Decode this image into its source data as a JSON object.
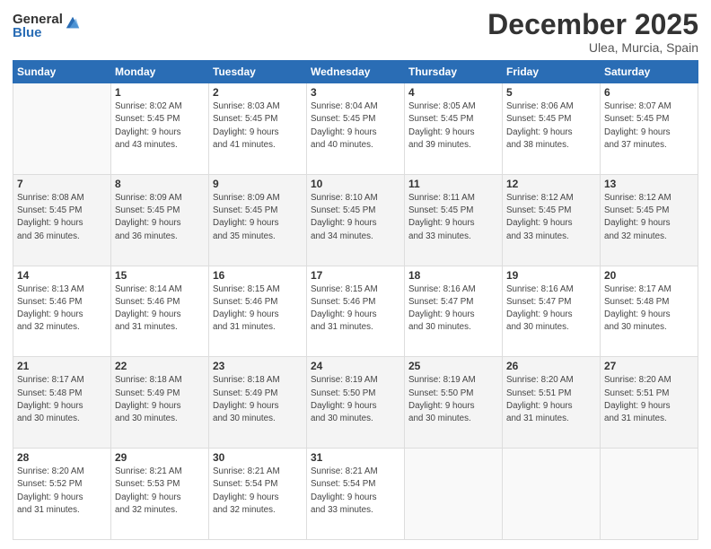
{
  "logo": {
    "general": "General",
    "blue": "Blue"
  },
  "header": {
    "month": "December 2025",
    "location": "Ulea, Murcia, Spain"
  },
  "days_of_week": [
    "Sunday",
    "Monday",
    "Tuesday",
    "Wednesday",
    "Thursday",
    "Friday",
    "Saturday"
  ],
  "weeks": [
    [
      {
        "day": "",
        "info": ""
      },
      {
        "day": "1",
        "info": "Sunrise: 8:02 AM\nSunset: 5:45 PM\nDaylight: 9 hours\nand 43 minutes."
      },
      {
        "day": "2",
        "info": "Sunrise: 8:03 AM\nSunset: 5:45 PM\nDaylight: 9 hours\nand 41 minutes."
      },
      {
        "day": "3",
        "info": "Sunrise: 8:04 AM\nSunset: 5:45 PM\nDaylight: 9 hours\nand 40 minutes."
      },
      {
        "day": "4",
        "info": "Sunrise: 8:05 AM\nSunset: 5:45 PM\nDaylight: 9 hours\nand 39 minutes."
      },
      {
        "day": "5",
        "info": "Sunrise: 8:06 AM\nSunset: 5:45 PM\nDaylight: 9 hours\nand 38 minutes."
      },
      {
        "day": "6",
        "info": "Sunrise: 8:07 AM\nSunset: 5:45 PM\nDaylight: 9 hours\nand 37 minutes."
      }
    ],
    [
      {
        "day": "7",
        "info": "Sunrise: 8:08 AM\nSunset: 5:45 PM\nDaylight: 9 hours\nand 36 minutes."
      },
      {
        "day": "8",
        "info": "Sunrise: 8:09 AM\nSunset: 5:45 PM\nDaylight: 9 hours\nand 36 minutes."
      },
      {
        "day": "9",
        "info": "Sunrise: 8:09 AM\nSunset: 5:45 PM\nDaylight: 9 hours\nand 35 minutes."
      },
      {
        "day": "10",
        "info": "Sunrise: 8:10 AM\nSunset: 5:45 PM\nDaylight: 9 hours\nand 34 minutes."
      },
      {
        "day": "11",
        "info": "Sunrise: 8:11 AM\nSunset: 5:45 PM\nDaylight: 9 hours\nand 33 minutes."
      },
      {
        "day": "12",
        "info": "Sunrise: 8:12 AM\nSunset: 5:45 PM\nDaylight: 9 hours\nand 33 minutes."
      },
      {
        "day": "13",
        "info": "Sunrise: 8:12 AM\nSunset: 5:45 PM\nDaylight: 9 hours\nand 32 minutes."
      }
    ],
    [
      {
        "day": "14",
        "info": "Sunrise: 8:13 AM\nSunset: 5:46 PM\nDaylight: 9 hours\nand 32 minutes."
      },
      {
        "day": "15",
        "info": "Sunrise: 8:14 AM\nSunset: 5:46 PM\nDaylight: 9 hours\nand 31 minutes."
      },
      {
        "day": "16",
        "info": "Sunrise: 8:15 AM\nSunset: 5:46 PM\nDaylight: 9 hours\nand 31 minutes."
      },
      {
        "day": "17",
        "info": "Sunrise: 8:15 AM\nSunset: 5:46 PM\nDaylight: 9 hours\nand 31 minutes."
      },
      {
        "day": "18",
        "info": "Sunrise: 8:16 AM\nSunset: 5:47 PM\nDaylight: 9 hours\nand 30 minutes."
      },
      {
        "day": "19",
        "info": "Sunrise: 8:16 AM\nSunset: 5:47 PM\nDaylight: 9 hours\nand 30 minutes."
      },
      {
        "day": "20",
        "info": "Sunrise: 8:17 AM\nSunset: 5:48 PM\nDaylight: 9 hours\nand 30 minutes."
      }
    ],
    [
      {
        "day": "21",
        "info": "Sunrise: 8:17 AM\nSunset: 5:48 PM\nDaylight: 9 hours\nand 30 minutes."
      },
      {
        "day": "22",
        "info": "Sunrise: 8:18 AM\nSunset: 5:49 PM\nDaylight: 9 hours\nand 30 minutes."
      },
      {
        "day": "23",
        "info": "Sunrise: 8:18 AM\nSunset: 5:49 PM\nDaylight: 9 hours\nand 30 minutes."
      },
      {
        "day": "24",
        "info": "Sunrise: 8:19 AM\nSunset: 5:50 PM\nDaylight: 9 hours\nand 30 minutes."
      },
      {
        "day": "25",
        "info": "Sunrise: 8:19 AM\nSunset: 5:50 PM\nDaylight: 9 hours\nand 30 minutes."
      },
      {
        "day": "26",
        "info": "Sunrise: 8:20 AM\nSunset: 5:51 PM\nDaylight: 9 hours\nand 31 minutes."
      },
      {
        "day": "27",
        "info": "Sunrise: 8:20 AM\nSunset: 5:51 PM\nDaylight: 9 hours\nand 31 minutes."
      }
    ],
    [
      {
        "day": "28",
        "info": "Sunrise: 8:20 AM\nSunset: 5:52 PM\nDaylight: 9 hours\nand 31 minutes."
      },
      {
        "day": "29",
        "info": "Sunrise: 8:21 AM\nSunset: 5:53 PM\nDaylight: 9 hours\nand 32 minutes."
      },
      {
        "day": "30",
        "info": "Sunrise: 8:21 AM\nSunset: 5:54 PM\nDaylight: 9 hours\nand 32 minutes."
      },
      {
        "day": "31",
        "info": "Sunrise: 8:21 AM\nSunset: 5:54 PM\nDaylight: 9 hours\nand 33 minutes."
      },
      {
        "day": "",
        "info": ""
      },
      {
        "day": "",
        "info": ""
      },
      {
        "day": "",
        "info": ""
      }
    ]
  ]
}
